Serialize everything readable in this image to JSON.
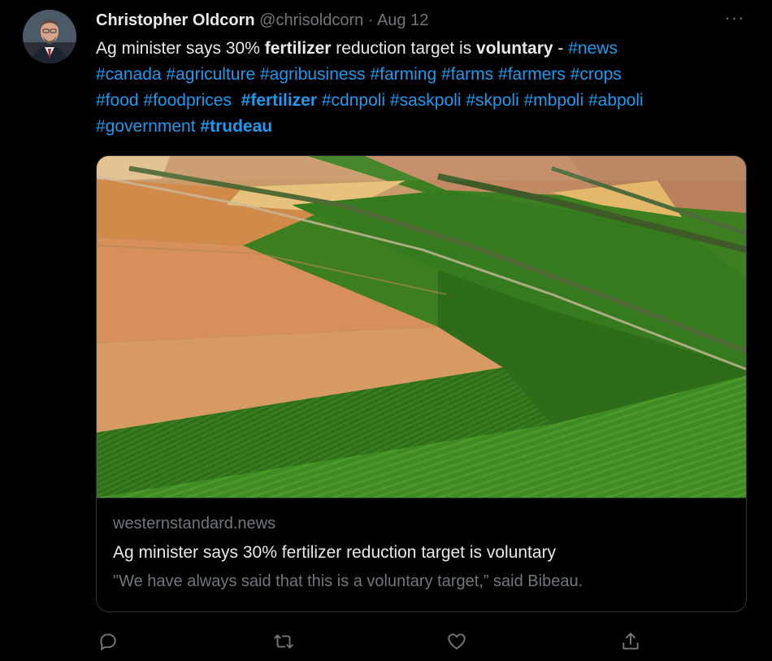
{
  "tweet": {
    "author": {
      "display_name": "Christopher Oldcorn",
      "handle": "@chrisoldcorn",
      "separator": "·",
      "timestamp": "Aug 12"
    },
    "more_label": "···",
    "text_parts": {
      "p1": "Ag minister says 30% ",
      "p2": "fertilizer",
      "p3": " reduction target is ",
      "p4": "voluntary",
      "p5": " - ",
      "tags_line1": [
        "#news"
      ],
      "tags_line2": [
        "#canada",
        "#agriculture",
        "#agribusiness",
        "#farming",
        "#farms",
        "#farmers",
        "#crops"
      ],
      "tag_food": "#food",
      "tag_foodprices": "#foodprices",
      "tag_fertilizer": "#fertilizer",
      "tags_line3_rest": [
        "#cdnpoli",
        "#saskpoli",
        "#skpoli",
        "#mbpoli",
        "#abpoli"
      ],
      "tag_government": "#government",
      "tag_trudeau": "#trudeau"
    },
    "card": {
      "domain": "westernstandard.news",
      "title": "Ag minister says 30% fertilizer reduction target is voluntary",
      "description": "\"We have always said that this is a voluntary target,” said Bibeau."
    },
    "actions": {
      "reply_icon": "reply-icon",
      "retweet_icon": "retweet-icon",
      "like_icon": "heart-icon",
      "share_icon": "share-icon"
    },
    "colors": {
      "background": "#000000",
      "text": "#e7e9ea",
      "secondary": "#71767b",
      "link": "#1d9bf0",
      "border": "#2f3336"
    }
  }
}
